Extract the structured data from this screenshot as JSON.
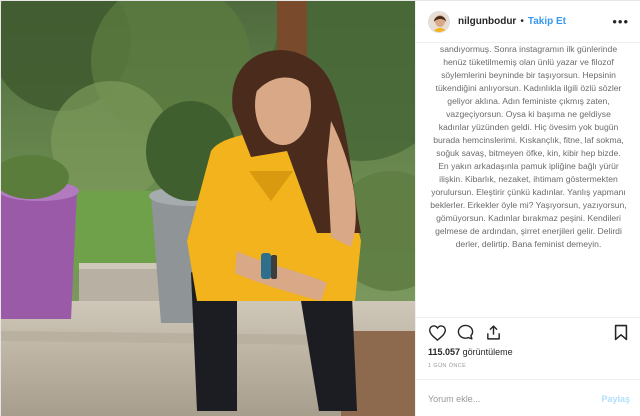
{
  "post": {
    "username": "nilgunbodur",
    "separator": "•",
    "follow_label": "Takip Et",
    "more_label": "•••",
    "caption": "sandıyormuş. Sonra instagramın ilk günlerinde henüz tüketilmemiş olan ünlü yazar ve filozof söylemlerini beyninde bir taşıyorsun. Hepsinin tükendiğini anlıyorsun. Kadınlıkla ilgili özlü sözler geliyor aklına. Adın feministe çıkmış zaten, vazgeçiyorsun. Oysa ki başıma ne geldiyse kadınlar yüzünden geldi. Hiç övesim yok bugün burada hemcinslerimi. Kıskançlık, fitne, laf sokma, soğuk savaş, bitmeyen öfke, kin, kibir hep bizde. En yakın arkadaşınla pamuk ipliğine bağlı yürür ilişkin. Kibarlık, nezaket, ihtimam göstermekten yorulursun. Eleştirir çünkü kadınlar. Yanlış yapmanı beklerler. Erkekler öyle mi? Yaşıyorsun, yazıyorsun, gömüyorsun. Kadınlar bırakmaz peşini. Kendileri gelmese de ardından, şirret enerjileri gelir. Delirdi derler, delirtip. Bana feminist demeyin.",
    "views_count": "115.057",
    "views_label": "görüntüleme",
    "time_ago": "1 GÜN ÖNCE",
    "comment_placeholder": "Yorum ekle...",
    "share_label": "Paylaş"
  },
  "colors": {
    "accent": "#3897f0",
    "shirt": "#f2b31c",
    "pot": "#9b5aa8"
  },
  "icons": [
    "heart-icon",
    "comment-icon",
    "share-icon",
    "bookmark-icon",
    "more-icon"
  ]
}
